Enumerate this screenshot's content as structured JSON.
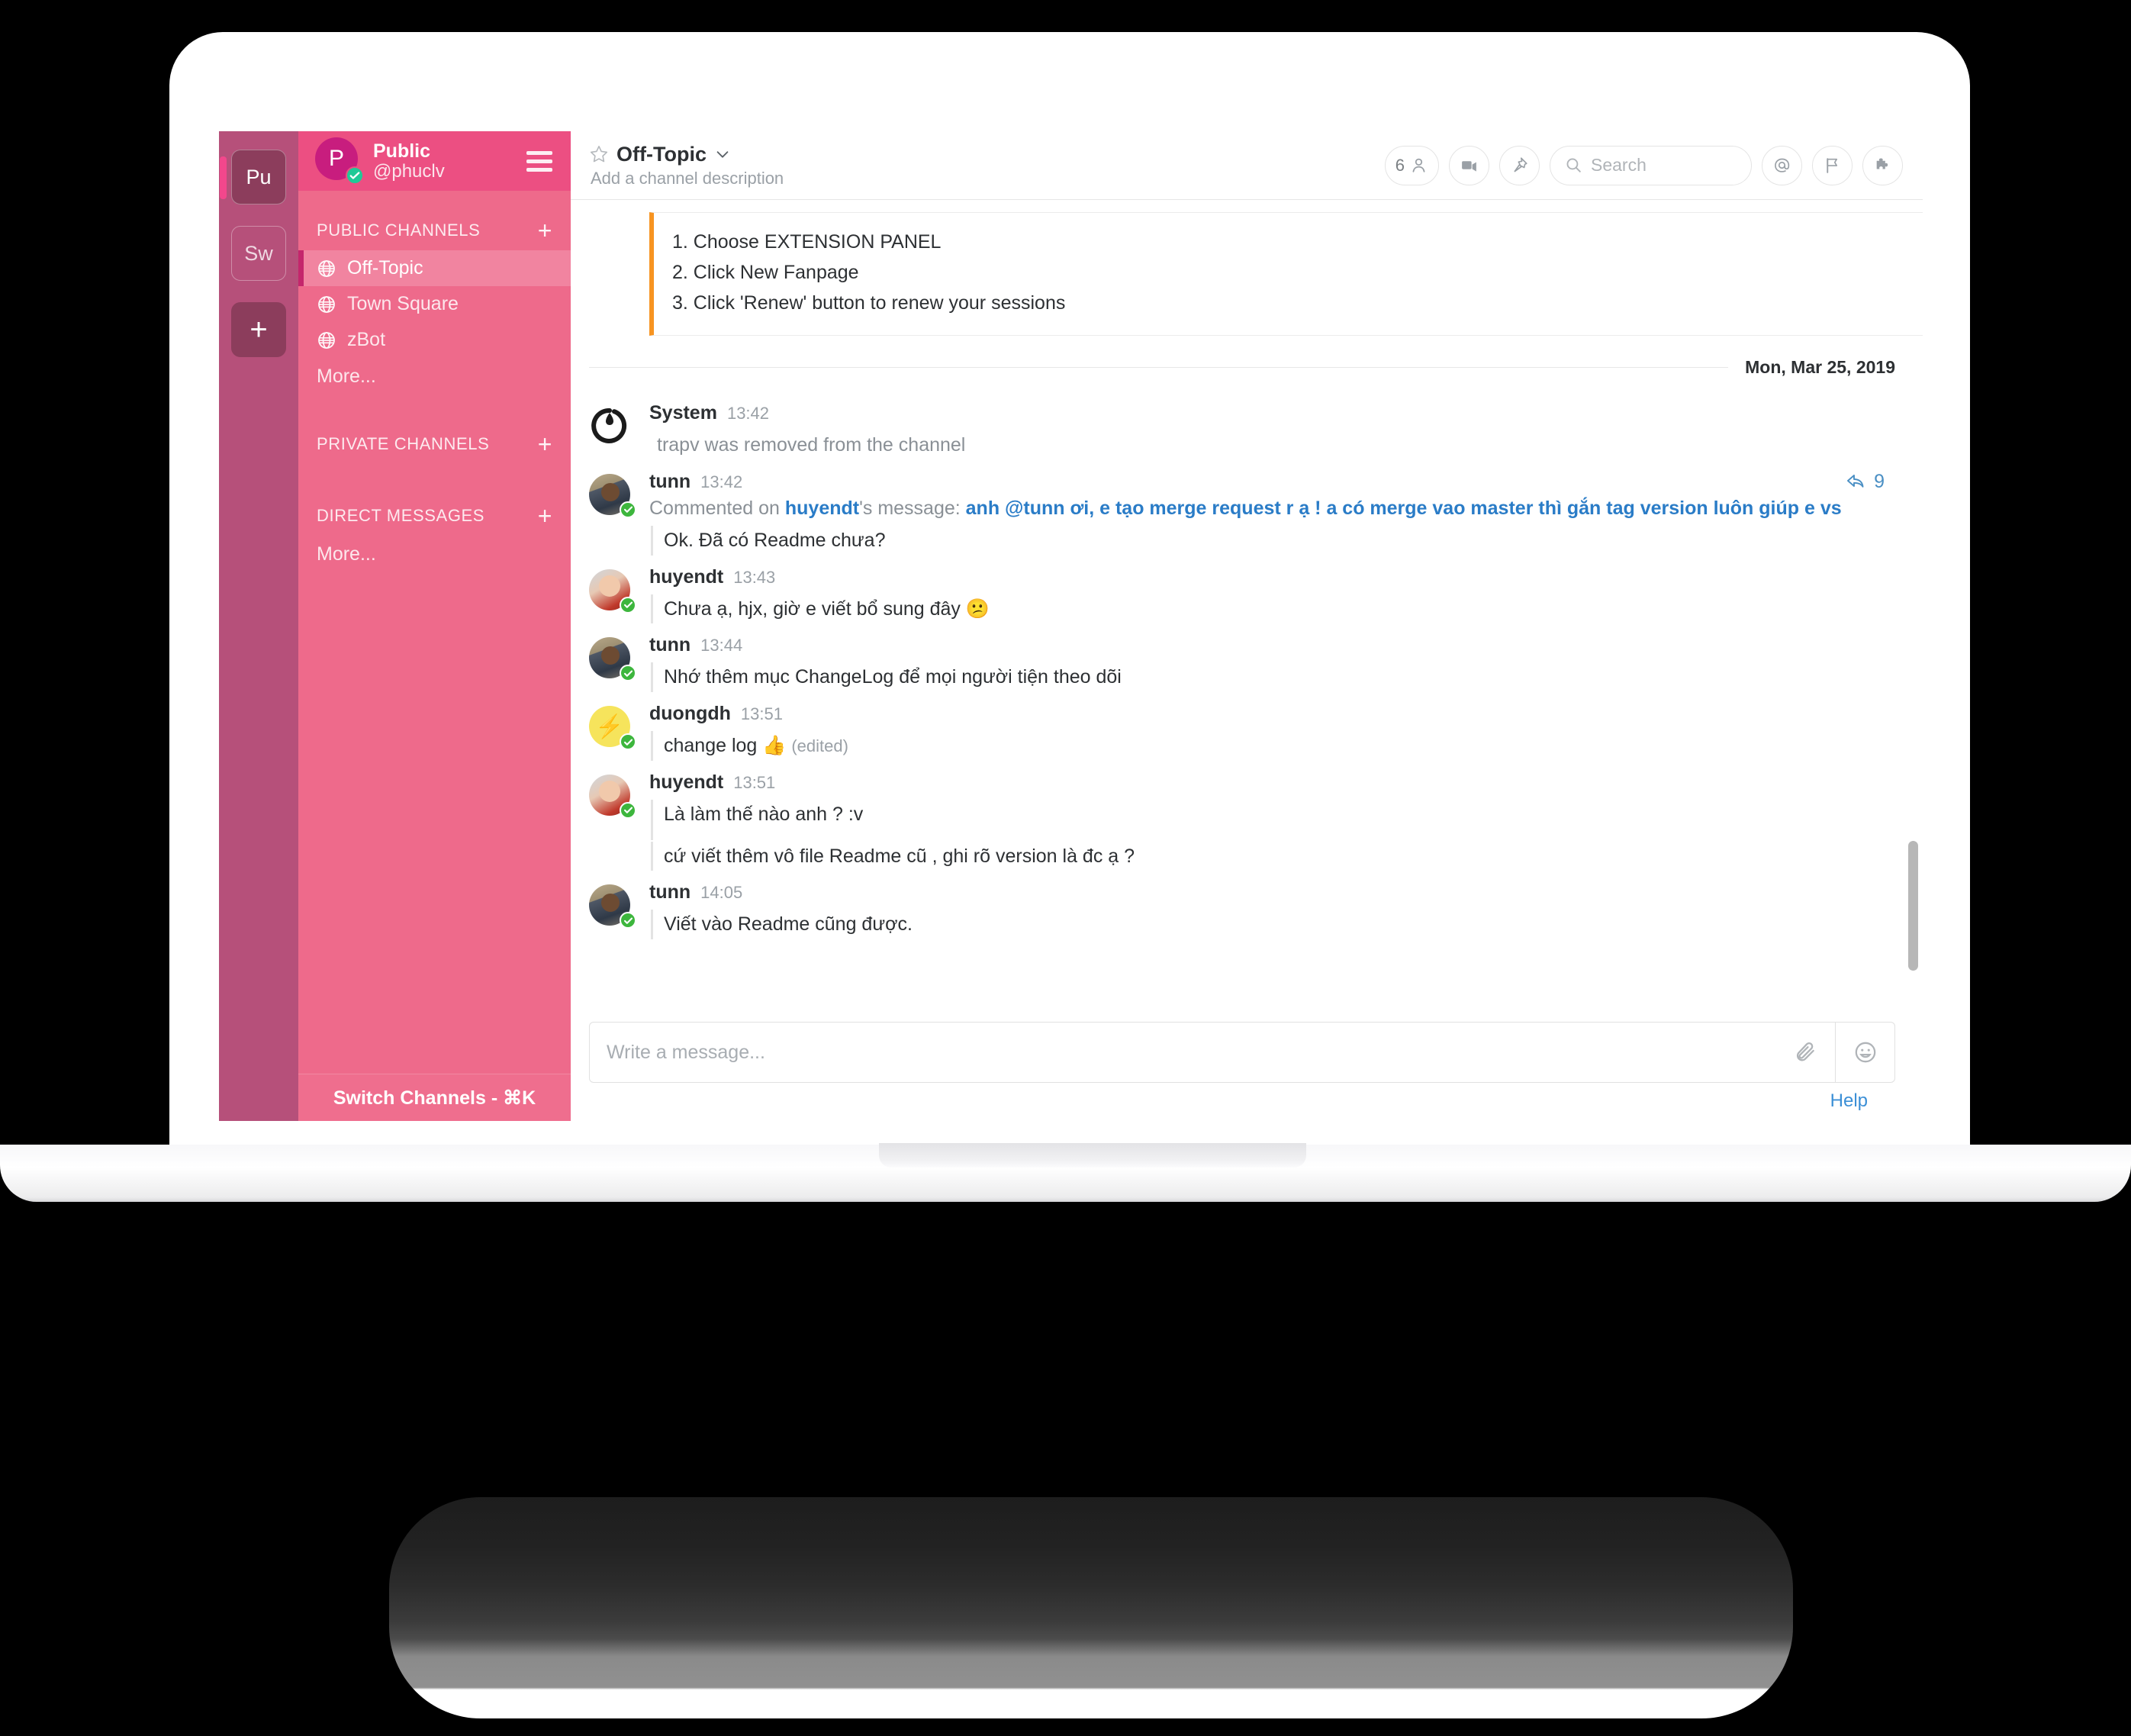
{
  "team_bar": {
    "items": [
      {
        "label": "Pu",
        "active": true
      },
      {
        "label": "Sw",
        "active": false
      }
    ],
    "add_label": "+"
  },
  "sidebar": {
    "team_name": "Public",
    "username": "@phuclv",
    "avatar_initial": "P",
    "groups": [
      {
        "title": "PUBLIC CHANNELS",
        "add_label": "+",
        "items": [
          {
            "label": "Off-Topic",
            "active": true
          },
          {
            "label": "Town Square",
            "active": false
          },
          {
            "label": "zBot",
            "active": false
          }
        ],
        "more_label": "More..."
      },
      {
        "title": "PRIVATE CHANNELS",
        "add_label": "+",
        "items": [],
        "more_label": ""
      },
      {
        "title": "DIRECT MESSAGES",
        "add_label": "+",
        "items": [],
        "more_label": "More..."
      }
    ],
    "footer_label": "Switch Channels - ⌘K"
  },
  "header": {
    "channel_name": "Off-Topic",
    "channel_description": "Add a channel description",
    "member_count": "6",
    "search_placeholder": "Search"
  },
  "messages": {
    "pinned_quote": {
      "lines": [
        "1. Choose EXTENSION PANEL",
        "2. Click New Fanpage",
        "3. Click 'Renew' button to renew your sessions"
      ]
    },
    "day_divider": "Mon, Mar 25, 2019",
    "items": [
      {
        "author": "System",
        "time": "13:42",
        "avatar": "a-sys",
        "verified": false,
        "kind": "system",
        "text": "trapv was removed from the channel"
      },
      {
        "author": "tunn",
        "time": "13:42",
        "avatar": "a-tunn",
        "verified": true,
        "kind": "comment",
        "comment_prefix": "Commented on ",
        "comment_author": "huyendt",
        "comment_mid": "'s message: ",
        "comment_quote": "anh @tunn ơi, e tạo merge request r ạ ! a có merge vao master thì gắn tag version luôn giúp e vs",
        "text": "Ok. Đã có Readme chưa?",
        "reply_count": "9"
      },
      {
        "author": "huyendt",
        "time": "13:43",
        "avatar": "a-huyen",
        "verified": true,
        "kind": "text",
        "text": "Chưa ạ, hjx, giờ e viết bổ sung đây 😕"
      },
      {
        "author": "tunn",
        "time": "13:44",
        "avatar": "a-tunn",
        "verified": true,
        "kind": "text",
        "text": "Nhớ thêm mục ChangeLog để mọi người tiện theo dõi"
      },
      {
        "author": "duongdh",
        "time": "13:51",
        "avatar": "a-duong",
        "verified": true,
        "kind": "edited",
        "text": "change log 👍",
        "edited_label": "(edited)"
      },
      {
        "author": "huyendt",
        "time": "13:51",
        "avatar": "a-huyen",
        "verified": true,
        "kind": "text2",
        "text": "Là làm thế nào anh ? :v",
        "text2": "cứ viết thêm vô file Readme cũ , ghi rõ version là đc ạ ?"
      },
      {
        "author": "tunn",
        "time": "14:05",
        "avatar": "a-tunn",
        "verified": true,
        "kind": "text",
        "text": "Viết vào Readme cũng được."
      }
    ]
  },
  "composer": {
    "placeholder": "Write a message...",
    "help_label": "Help"
  },
  "colors": {
    "sidebar_bg": "#ee6a8b",
    "sidebar_header_bg": "#ec4f82",
    "team_bar_bg": "#b6507a",
    "accent_quote": "#f79421",
    "link_blue": "#2a7cc7"
  }
}
